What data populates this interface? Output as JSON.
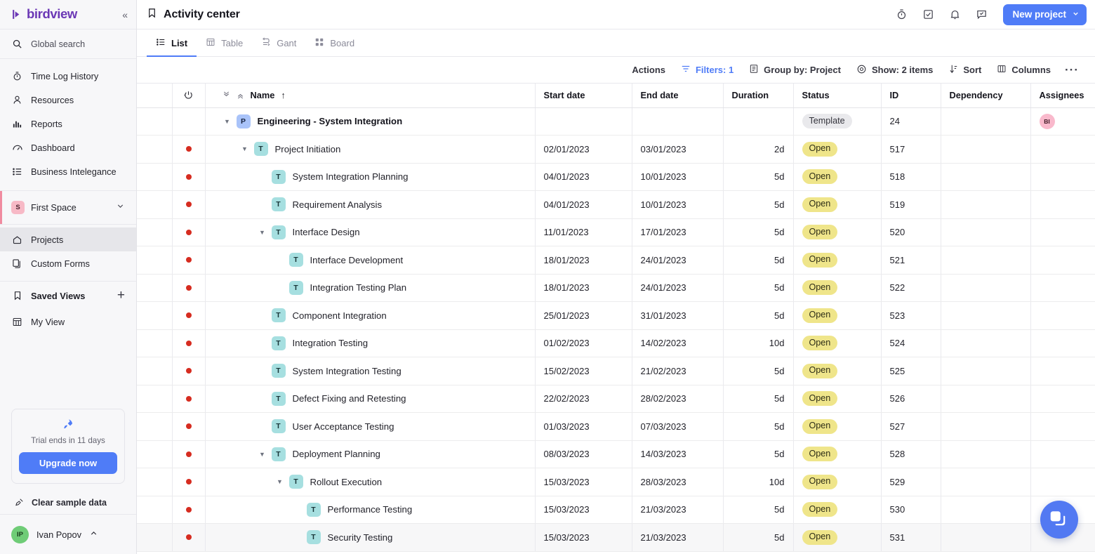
{
  "brand": {
    "name": "birdview",
    "collapse_label": "«"
  },
  "sidebar": {
    "search": {
      "label": "Global search",
      "icon": "search-icon"
    },
    "nav": [
      {
        "label": "Time Log History",
        "icon": "timer-icon"
      },
      {
        "label": "Resources",
        "icon": "user-icon"
      },
      {
        "label": "Reports",
        "icon": "bar-chart-icon"
      },
      {
        "label": "Dashboard",
        "icon": "gauge-icon"
      },
      {
        "label": "Business Intelegance",
        "icon": "list-icon"
      }
    ],
    "space": {
      "badge": "S",
      "name": "First Space",
      "icon": "chevron-down-icon"
    },
    "space_items": [
      {
        "label": "Projects",
        "icon": "home-icon",
        "active": true
      },
      {
        "label": "Custom Forms",
        "icon": "forms-icon",
        "active": false
      }
    ],
    "saved_views": {
      "title": "Saved Views",
      "icon": "bookmark-icon",
      "add_label": "+",
      "items": [
        {
          "label": "My View",
          "icon": "table-icon"
        }
      ]
    },
    "trial": {
      "icon": "rocket-icon",
      "text": "Trial ends in 11 days",
      "button": "Upgrade now"
    },
    "clear_sample": {
      "label": "Clear sample data",
      "icon": "broom-icon"
    },
    "user": {
      "initials": "IP",
      "name": "Ivan Popov",
      "caret": "chevron-up-icon"
    }
  },
  "topbar": {
    "title": "Activity center",
    "title_icon": "bookmark-icon",
    "icons": [
      {
        "name": "timer-icon"
      },
      {
        "name": "checkbox-icon"
      },
      {
        "name": "bell-icon"
      },
      {
        "name": "chat-icon"
      }
    ],
    "new_project": {
      "label": "New project",
      "caret": "chevron-down-icon"
    }
  },
  "tabs": [
    {
      "label": "List",
      "icon": "list-icon",
      "active": true
    },
    {
      "label": "Table",
      "icon": "table-icon",
      "active": false
    },
    {
      "label": "Gant",
      "icon": "gantt-icon",
      "active": false
    },
    {
      "label": "Board",
      "icon": "board-icon",
      "active": false
    }
  ],
  "toolbar": [
    {
      "label": "Actions",
      "icon": null,
      "accent": false
    },
    {
      "label": "Filters: 1",
      "icon": "filter-icon",
      "accent": true
    },
    {
      "label": "Group by: Project",
      "icon": "group-icon",
      "accent": false
    },
    {
      "label": "Show: 2 items",
      "icon": "eye-icon",
      "accent": false
    },
    {
      "label": "Sort",
      "icon": "sort-icon",
      "accent": false
    },
    {
      "label": "Columns",
      "icon": "columns-icon",
      "accent": false
    },
    {
      "label": "···",
      "icon": null,
      "accent": false
    }
  ],
  "table": {
    "columns": [
      {
        "key": "select",
        "label": ""
      },
      {
        "key": "flag",
        "label": "",
        "icon": "power-icon"
      },
      {
        "key": "name",
        "label": "Name",
        "sort": "↑"
      },
      {
        "key": "start_date",
        "label": "Start date"
      },
      {
        "key": "end_date",
        "label": "End date"
      },
      {
        "key": "duration",
        "label": "Duration"
      },
      {
        "key": "status",
        "label": "Status"
      },
      {
        "key": "id",
        "label": "ID"
      },
      {
        "key": "dependency",
        "label": "Dependency"
      },
      {
        "key": "assignees",
        "label": "Assignees"
      }
    ],
    "rows": [
      {
        "flag": false,
        "twisty": "down",
        "indent": 0,
        "type": "P",
        "name": "Engineering - System Integration",
        "is_project": true,
        "start_date": "",
        "end_date": "",
        "duration": "",
        "status": "Template",
        "status_kind": "template",
        "id": "24",
        "dependency": "",
        "assignee": "BI"
      },
      {
        "flag": true,
        "twisty": "down",
        "indent": 1,
        "type": "T",
        "name": "Project Initiation",
        "start_date": "02/01/2023",
        "end_date": "03/01/2023",
        "duration": "2d",
        "status": "Open",
        "status_kind": "open",
        "id": "517",
        "dependency": "",
        "assignee": ""
      },
      {
        "flag": true,
        "twisty": "none",
        "indent": 2,
        "type": "T",
        "name": "System Integration Planning",
        "start_date": "04/01/2023",
        "end_date": "10/01/2023",
        "duration": "5d",
        "status": "Open",
        "status_kind": "open",
        "id": "518",
        "dependency": "",
        "assignee": ""
      },
      {
        "flag": true,
        "twisty": "none",
        "indent": 2,
        "type": "T",
        "name": "Requirement Analysis",
        "start_date": "04/01/2023",
        "end_date": "10/01/2023",
        "duration": "5d",
        "status": "Open",
        "status_kind": "open",
        "id": "519",
        "dependency": "",
        "assignee": ""
      },
      {
        "flag": true,
        "twisty": "down",
        "indent": 2,
        "type": "T",
        "name": "Interface Design",
        "start_date": "11/01/2023",
        "end_date": "17/01/2023",
        "duration": "5d",
        "status": "Open",
        "status_kind": "open",
        "id": "520",
        "dependency": "",
        "assignee": ""
      },
      {
        "flag": true,
        "twisty": "none",
        "indent": 3,
        "type": "T",
        "name": "Interface Development",
        "start_date": "18/01/2023",
        "end_date": "24/01/2023",
        "duration": "5d",
        "status": "Open",
        "status_kind": "open",
        "id": "521",
        "dependency": "",
        "assignee": ""
      },
      {
        "flag": true,
        "twisty": "none",
        "indent": 3,
        "type": "T",
        "name": "Integration Testing Plan",
        "start_date": "18/01/2023",
        "end_date": "24/01/2023",
        "duration": "5d",
        "status": "Open",
        "status_kind": "open",
        "id": "522",
        "dependency": "",
        "assignee": ""
      },
      {
        "flag": true,
        "twisty": "none",
        "indent": 2,
        "type": "T",
        "name": "Component Integration",
        "start_date": "25/01/2023",
        "end_date": "31/01/2023",
        "duration": "5d",
        "status": "Open",
        "status_kind": "open",
        "id": "523",
        "dependency": "",
        "assignee": ""
      },
      {
        "flag": true,
        "twisty": "none",
        "indent": 2,
        "type": "T",
        "name": "Integration Testing",
        "start_date": "01/02/2023",
        "end_date": "14/02/2023",
        "duration": "10d",
        "status": "Open",
        "status_kind": "open",
        "id": "524",
        "dependency": "",
        "assignee": ""
      },
      {
        "flag": true,
        "twisty": "none",
        "indent": 2,
        "type": "T",
        "name": "System Integration Testing",
        "start_date": "15/02/2023",
        "end_date": "21/02/2023",
        "duration": "5d",
        "status": "Open",
        "status_kind": "open",
        "id": "525",
        "dependency": "",
        "assignee": ""
      },
      {
        "flag": true,
        "twisty": "none",
        "indent": 2,
        "type": "T",
        "name": "Defect Fixing and Retesting",
        "start_date": "22/02/2023",
        "end_date": "28/02/2023",
        "duration": "5d",
        "status": "Open",
        "status_kind": "open",
        "id": "526",
        "dependency": "",
        "assignee": ""
      },
      {
        "flag": true,
        "twisty": "none",
        "indent": 2,
        "type": "T",
        "name": "User Acceptance Testing",
        "start_date": "01/03/2023",
        "end_date": "07/03/2023",
        "duration": "5d",
        "status": "Open",
        "status_kind": "open",
        "id": "527",
        "dependency": "",
        "assignee": ""
      },
      {
        "flag": true,
        "twisty": "down",
        "indent": 2,
        "type": "T",
        "name": "Deployment Planning",
        "start_date": "08/03/2023",
        "end_date": "14/03/2023",
        "duration": "5d",
        "status": "Open",
        "status_kind": "open",
        "id": "528",
        "dependency": "",
        "assignee": ""
      },
      {
        "flag": true,
        "twisty": "down",
        "indent": 3,
        "type": "T",
        "name": "Rollout Execution",
        "start_date": "15/03/2023",
        "end_date": "28/03/2023",
        "duration": "10d",
        "status": "Open",
        "status_kind": "open",
        "id": "529",
        "dependency": "",
        "assignee": ""
      },
      {
        "flag": true,
        "twisty": "none",
        "indent": 4,
        "type": "T",
        "name": "Performance Testing",
        "start_date": "15/03/2023",
        "end_date": "21/03/2023",
        "duration": "5d",
        "status": "Open",
        "status_kind": "open",
        "id": "530",
        "dependency": "",
        "assignee": ""
      },
      {
        "flag": true,
        "twisty": "none",
        "indent": 4,
        "type": "T",
        "name": "Security Testing",
        "hovered": true,
        "start_date": "15/03/2023",
        "end_date": "21/03/2023",
        "duration": "5d",
        "status": "Open",
        "status_kind": "open",
        "id": "531",
        "dependency": "",
        "assignee": ""
      }
    ]
  },
  "help_fab": {
    "icon": "help-card-icon"
  },
  "colors": {
    "accent": "#4f7cf7",
    "brand": "#6b38b5",
    "overdue": "#e4392c",
    "open_badge": "#efe58a"
  }
}
